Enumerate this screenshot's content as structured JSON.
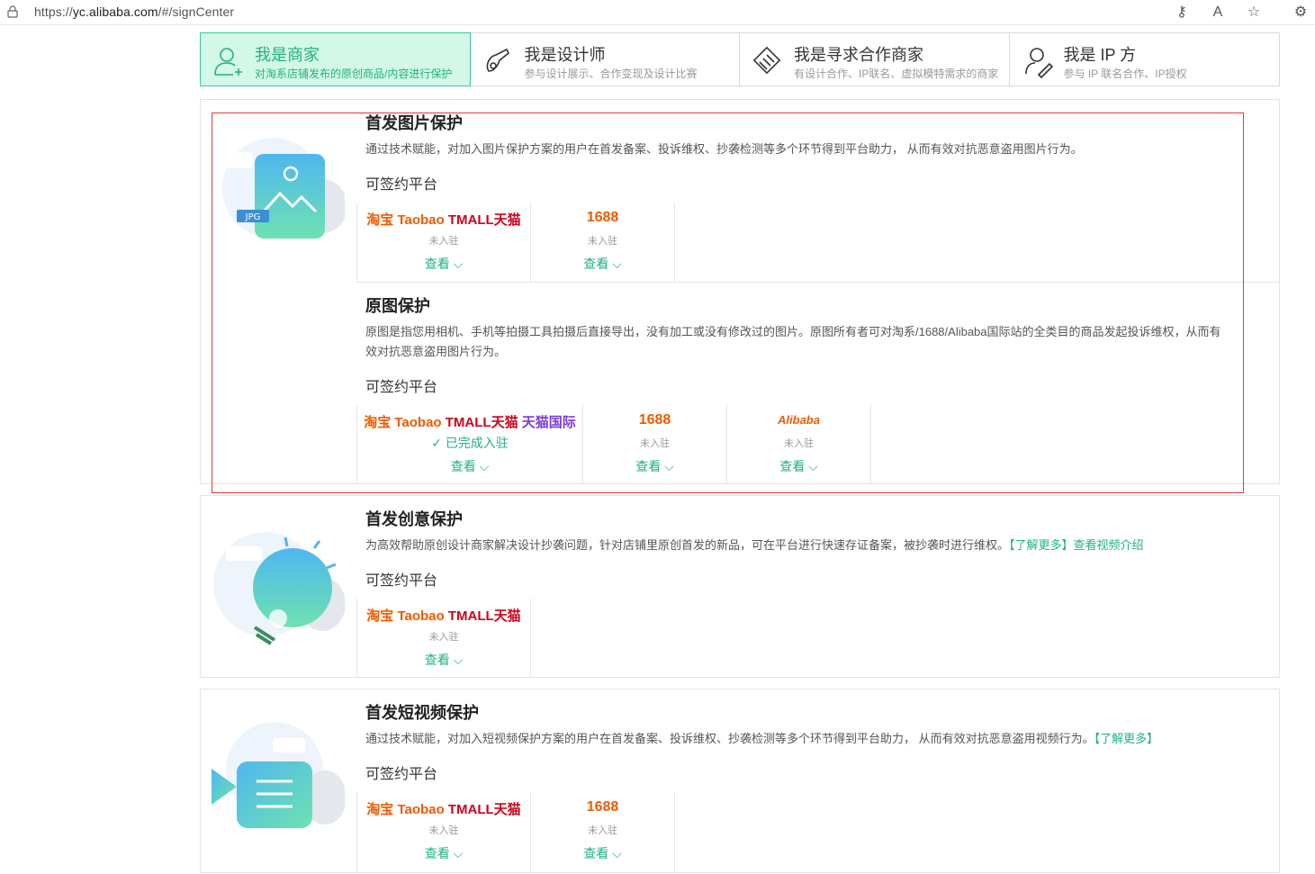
{
  "browser": {
    "url_prefix": "https://",
    "url_host": "yc.alibaba.com",
    "url_path": "/#/signCenter"
  },
  "tabs": [
    {
      "title": "我是商家",
      "subtitle": "对淘系店铺发布的原创商品/内容进行保护",
      "icon": "merchant-icon",
      "active": true
    },
    {
      "title": "我是设计师",
      "subtitle": "参与设计展示、合作变现及设计比赛",
      "icon": "designer-icon",
      "active": false
    },
    {
      "title": "我是寻求合作商家",
      "subtitle": "有设计合作、IP联名、虚拟模特需求的商家",
      "icon": "handshake-icon",
      "active": false
    },
    {
      "title": "我是 IP 方",
      "subtitle": "参与 IP 联名合作、IP授权",
      "icon": "ip-icon",
      "active": false
    }
  ],
  "common": {
    "platform_label": "可签约平台",
    "view_label": "查看",
    "not_joined": "未入驻",
    "joined": "已完成入驻"
  },
  "logos": {
    "taobao": "淘宝 Taobao",
    "tmall": "TMALL天猫",
    "tmall_global": "天猫国际",
    "s1688": "1688",
    "alibaba": "Alibaba"
  },
  "sections": {
    "image_first": {
      "title": "首发图片保护",
      "desc": "通过技术赋能，对加入图片保护方案的用户在首发备案、投诉维权、抄袭检测等多个环节得到平台助力， 从而有效对抗恶意盗用图片行为。",
      "illus_label": "JPG"
    },
    "original_image": {
      "title": "原图保护",
      "desc": "原图是指您用相机、手机等拍摄工具拍摄后直接导出，没有加工或没有修改过的图片。原图所有者可对淘系/1688/Alibaba国际站的全类目的商品发起投诉维权，从而有效对抗恶意盗用图片行为。"
    },
    "creative_first": {
      "title": "首发创意保护",
      "desc": "为高效帮助原创设计商家解决设计抄袭问题，针对店铺里原创首发的新品，可在平台进行快速存证备案，被抄袭时进行维权。",
      "link1": "【了解更多】",
      "link2": "查看视频介绍"
    },
    "video_first": {
      "title": "首发短视频保护",
      "desc": "通过技术赋能，对加入短视频保护方案的用户在首发备案、投诉维权、抄袭检测等多个环节得到平台助力， 从而有效对抗恶意盗用视频行为。",
      "link1": "【了解更多】"
    }
  },
  "colors": {
    "accent": "#1fb37c",
    "active_tab_bg": "#d3f8ea",
    "taobao": "#f05a00",
    "tmall": "#d0021b",
    "highlight_box": "#e53935"
  }
}
